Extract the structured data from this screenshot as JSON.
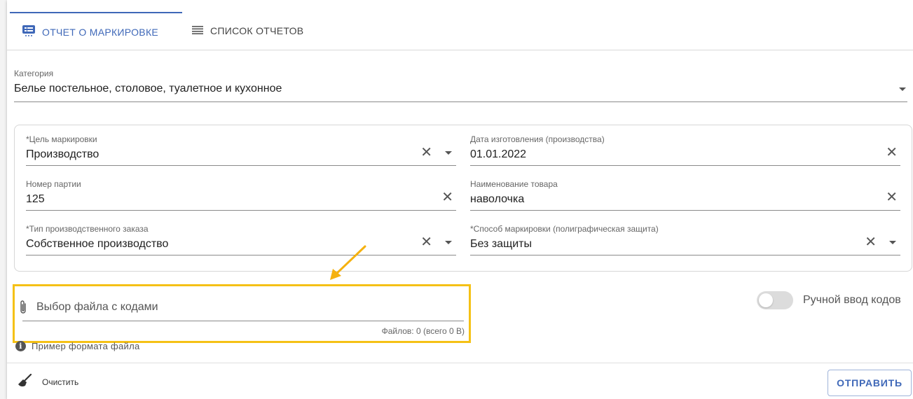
{
  "tabs": [
    {
      "label": "ОТЧЕТ О МАРКИРОВКЕ",
      "active": true,
      "icon": "report-icon"
    },
    {
      "label": "СПИСОК ОТЧЕТОВ",
      "active": false,
      "icon": "list-icon"
    }
  ],
  "category": {
    "label": "Категория",
    "value": "Белье постельное, столовое, туалетное и кухонное"
  },
  "fields": {
    "purpose": {
      "label": "*Цель маркировки",
      "value": "Производство"
    },
    "manufacture_date": {
      "label": "Дата изготовления (производства)",
      "value": "01.01.2022"
    },
    "batch_number": {
      "label": "Номер партии",
      "value": "125"
    },
    "product_name": {
      "label": "Наименование товара",
      "value": "наволочка"
    },
    "order_type": {
      "label": "*Тип производственного заказа",
      "value": "Собственное производство"
    },
    "marking_method": {
      "label": "*Способ маркировки (полиграфическая защита)",
      "value": "Без защиты"
    }
  },
  "file_picker": {
    "placeholder": "Выбор файла с кодами",
    "count_text": "Файлов: 0 (всего 0 В)"
  },
  "example_link": "Пример формата файла",
  "manual_toggle": {
    "label": "Ручной ввод кодов",
    "enabled": false
  },
  "actions": {
    "clear_label": "Очистить",
    "submit_label": "ОТПРАВИТЬ"
  },
  "colors": {
    "accent": "#3f68b8",
    "highlight": "#f5c116",
    "arrow": "#f5b10f"
  }
}
